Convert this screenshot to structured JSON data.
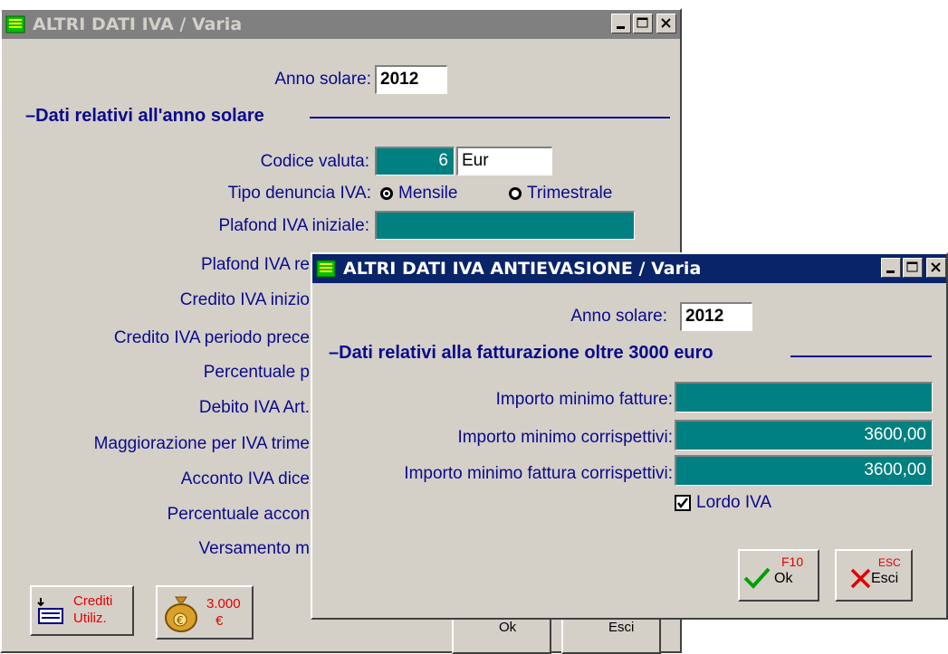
{
  "back_window": {
    "title": "ALTRI DATI IVA / Varia",
    "anno_label": "Anno solare:",
    "anno_value": "2012",
    "section_title": "Dati relativi all'anno solare",
    "codice_valuta_label": "Codice valuta:",
    "codice_valuta_value": "6",
    "valuta_name": "Eur",
    "tipo_denuncia_label": "Tipo denuncia IVA:",
    "radio_mensile": "Mensile",
    "radio_trimestrale": "Trimestrale",
    "selected_denuncia": "Mensile",
    "plafond_iniziale_label": "Plafond IVA iniziale:",
    "plafond_re_label": "Plafond IVA re",
    "credito_inizio_label": "Credito IVA inizio",
    "credito_periodo_label": "Credito IVA periodo prece",
    "percentuale_p_label": "Percentuale p",
    "debito_label": "Debito IVA Art.",
    "maggiorazione_label": "Maggiorazione per IVA trime",
    "acconto_label": "Acconto IVA dice",
    "percentuale_acconto_label": "Percentuale accon",
    "versamento_label": "Versamento m",
    "crediti_btn_line1": "Crediti",
    "crediti_btn_line2": "Utiliz.",
    "euro_btn_line1": "3.000",
    "euro_btn_line2": "€",
    "ok_partial": "Ok",
    "esci_partial": "Esci"
  },
  "front_window": {
    "title": "ALTRI DATI IVA ANTIEVASIONE / Varia",
    "anno_label": "Anno solare:",
    "anno_value": "2012",
    "section_title": "Dati relativi alla fatturazione oltre 3000 euro",
    "importo_fatture_label": "Importo minimo fatture:",
    "importo_fatture_value": "",
    "importo_corrispettivi_label": "Importo minimo corrispettivi:",
    "importo_corrispettivi_value": "3600,00",
    "importo_fattura_corr_label": "Importo minimo fattura corrispettivi:",
    "importo_fattura_corr_value": "3600,00",
    "lordo_iva_label": "Lordo IVA",
    "lordo_iva_checked": true,
    "ok_key": "F10",
    "ok_label": "Ok",
    "esci_key": "ESC",
    "esci_label": "Esci"
  },
  "colors": {
    "field_teal": "#008080",
    "label_blue": "#0a0a8c",
    "title_active": "#0a246a",
    "title_inactive": "#808080",
    "window_face": "#d4d0c8"
  }
}
